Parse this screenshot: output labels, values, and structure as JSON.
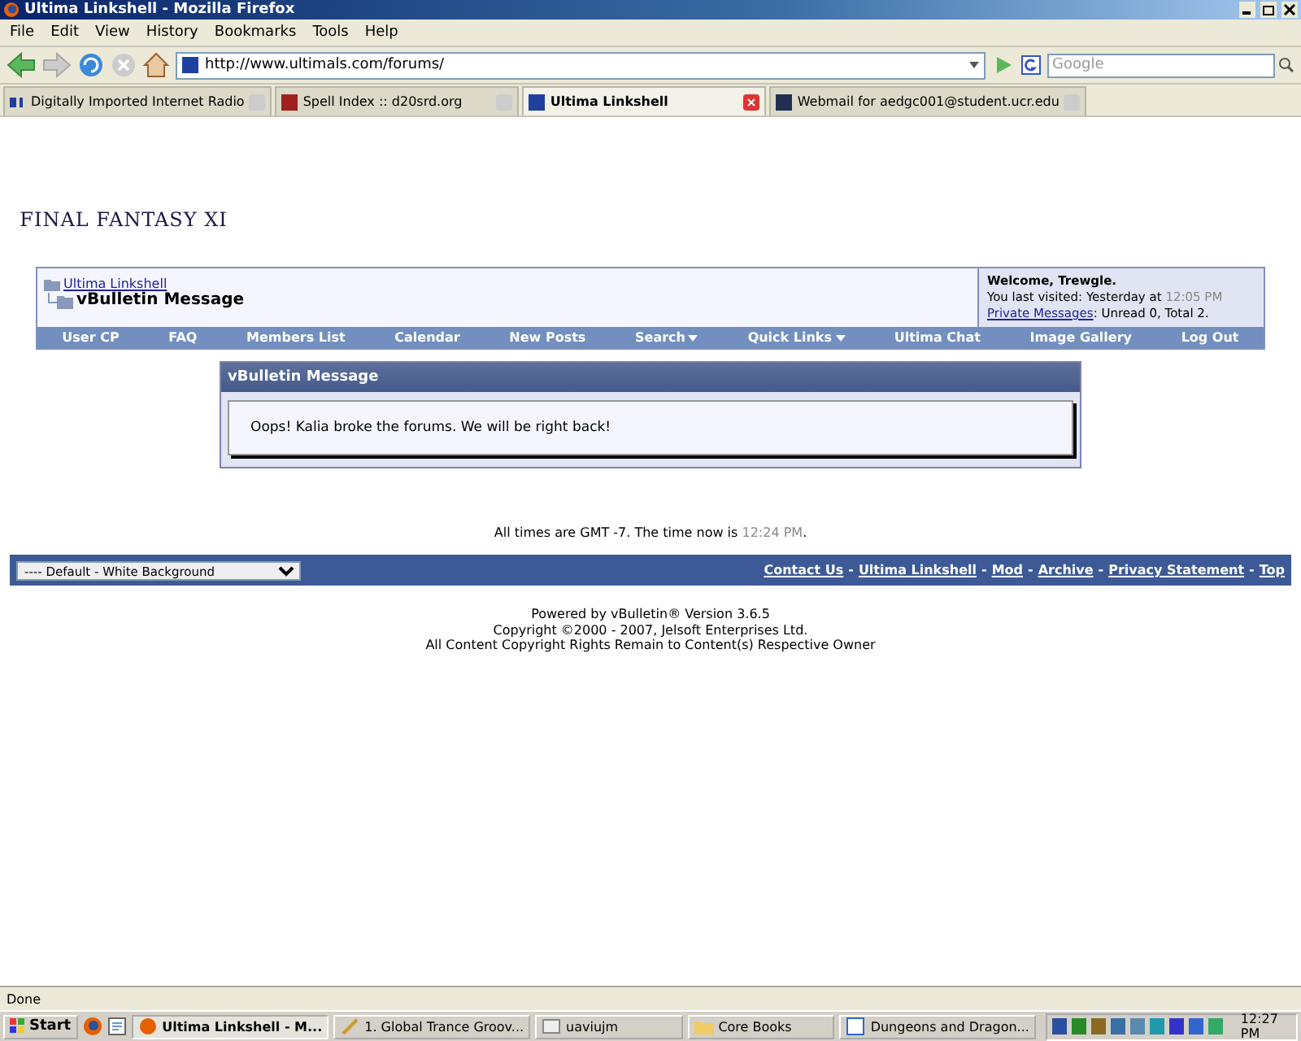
{
  "window": {
    "title": "Ultima Linkshell - Mozilla Firefox"
  },
  "menu": [
    "File",
    "Edit",
    "View",
    "History",
    "Bookmarks",
    "Tools",
    "Help"
  ],
  "address": {
    "value": "http://www.ultimals.com/forums/"
  },
  "search": {
    "placeholder": "Google"
  },
  "tabs": [
    {
      "label": "Digitally Imported Internet Radio",
      "selected": false
    },
    {
      "label": "Spell Index :: d20srd.org",
      "selected": false
    },
    {
      "label": "Ultima Linkshell",
      "selected": true
    },
    {
      "label": "Webmail for aedgc001@student.ucr.edu",
      "selected": false
    }
  ],
  "page": {
    "logo": "FINAL FANTASY XI",
    "breadcrumb": {
      "link": "Ultima Linkshell",
      "current": "vBulletin Message"
    },
    "welcome": {
      "title": "Welcome, Trewgle.",
      "last_visited": "You last visited: Yesterday at",
      "last_time": "12:05 PM",
      "pm_link": "Private Messages",
      "pm_text": ": Unread 0, Total 2."
    },
    "navbar": [
      {
        "label": "User CP",
        "dropdown": false
      },
      {
        "label": "FAQ",
        "dropdown": false
      },
      {
        "label": "Members List",
        "dropdown": false
      },
      {
        "label": "Calendar",
        "dropdown": false
      },
      {
        "label": "New Posts",
        "dropdown": false
      },
      {
        "label": "Search",
        "dropdown": true
      },
      {
        "label": "Quick Links",
        "dropdown": true
      },
      {
        "label": "Ultima Chat",
        "dropdown": false
      },
      {
        "label": "Image Gallery",
        "dropdown": false
      },
      {
        "label": "Log Out",
        "dropdown": false
      }
    ],
    "message": {
      "title": "vBulletin Message",
      "text": "Oops! Kalia broke the forums. We will be right back!"
    },
    "time_note": {
      "text": "All times are GMT -7. The time now is",
      "time": "12:24 PM",
      "end": "."
    },
    "style_select": {
      "value": "---- Default - White Background"
    },
    "footer_links": [
      "Contact Us",
      "Ultima Linkshell",
      "Mod",
      "Archive",
      "Privacy Statement",
      "Top"
    ],
    "footer_separator": "-",
    "copyright": [
      "Powered by vBulletin® Version 3.6.5",
      "Copyright ©2000 - 2007, Jelsoft Enterprises Ltd.",
      "All Content Copyright Rights Remain to Content(s) Respective Owner"
    ]
  },
  "status_bar": {
    "text": "Done"
  },
  "taskbar": {
    "start": "Start",
    "tasks": [
      {
        "label": "Ultima Linkshell - M...",
        "selected": true
      },
      {
        "label": "1. Global Trance Groov...",
        "selected": false
      },
      {
        "label": "uaviujm",
        "selected": false
      },
      {
        "label": "Core Books",
        "selected": false
      },
      {
        "label": "Dungeons and Dragon...",
        "selected": false
      }
    ],
    "clock": "12:27 PM"
  }
}
